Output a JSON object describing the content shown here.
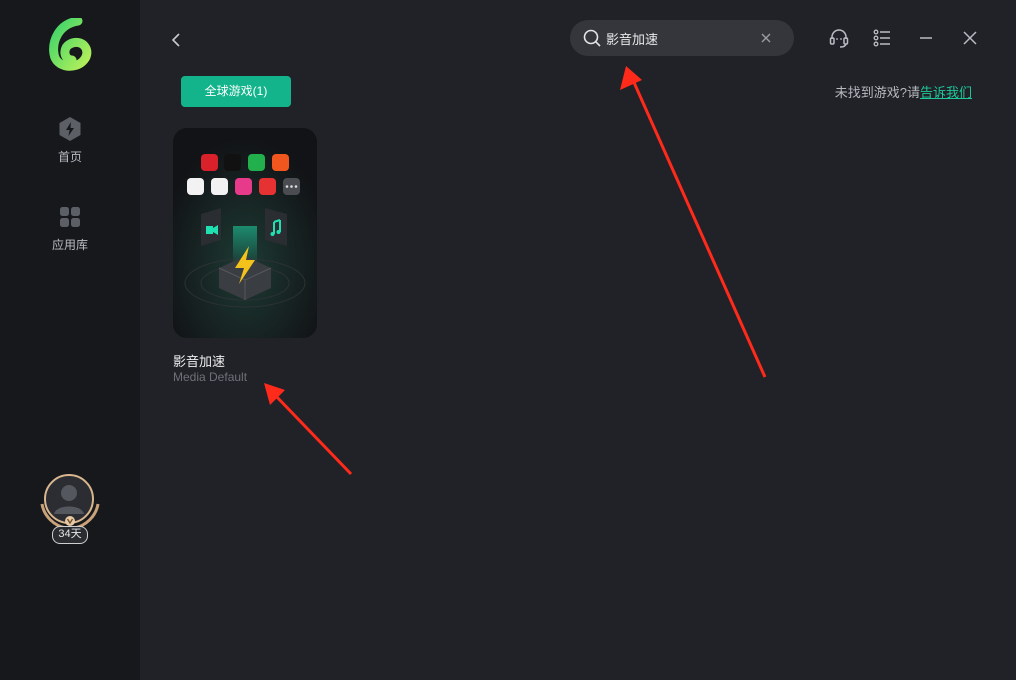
{
  "sidebar": {
    "items": [
      {
        "label": "首页",
        "icon": "lightning-hexagon-icon"
      },
      {
        "label": "应用库",
        "icon": "grid-apps-icon"
      }
    ],
    "membership_days": "34天"
  },
  "search": {
    "value": "影音加速"
  },
  "topbar_icons": [
    "headset-icon",
    "list-icon",
    "minimize-icon",
    "close-icon"
  ],
  "filter": {
    "label": "全球游戏(1)"
  },
  "notfound": {
    "prefix": "未找到游戏?请",
    "link": "告诉我们"
  },
  "results": [
    {
      "title": "影音加速",
      "subtitle": "Media Default"
    }
  ],
  "colors": {
    "accent": "#13b48b",
    "arrow": "#ff2a1a"
  }
}
